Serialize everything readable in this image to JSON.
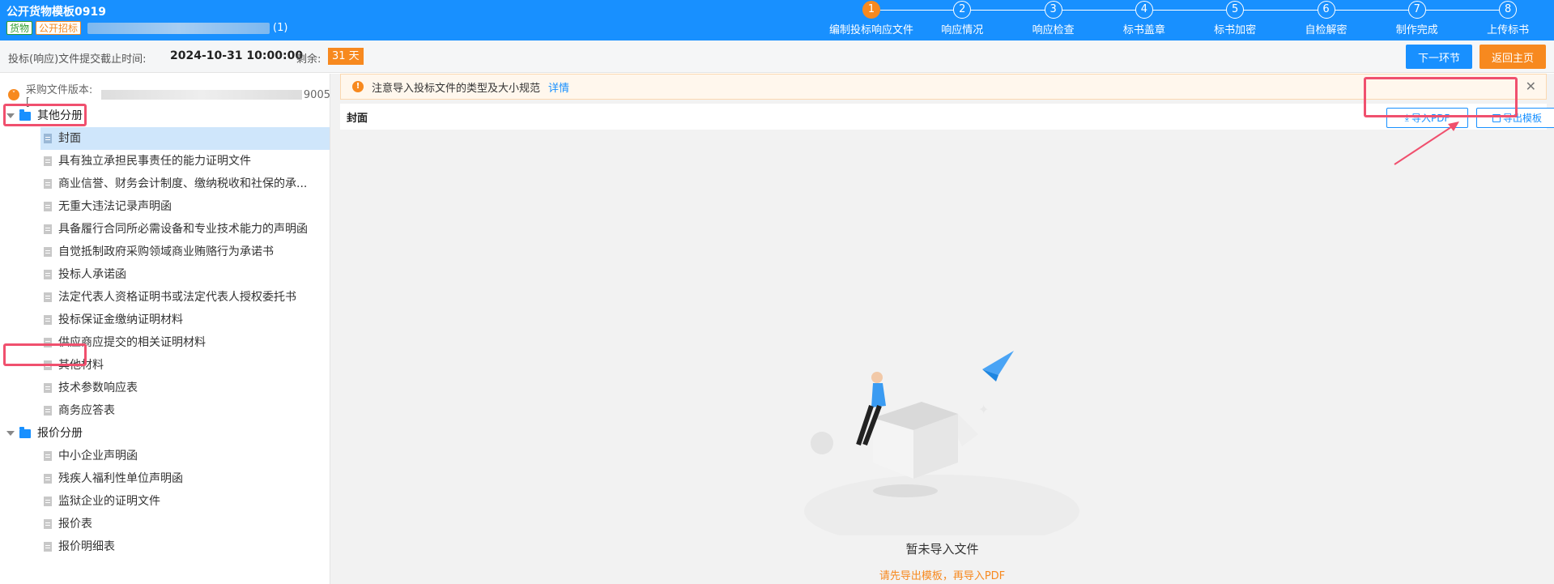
{
  "header": {
    "title": "公开货物模板0919",
    "tags": [
      "货物",
      "公开招标"
    ],
    "count_suffix": "(1)"
  },
  "steps": [
    {
      "num": "1",
      "label": "编制投标响应文件",
      "active": true
    },
    {
      "num": "2",
      "label": "响应情况",
      "active": false
    },
    {
      "num": "3",
      "label": "响应检查",
      "active": false
    },
    {
      "num": "4",
      "label": "标书盖章",
      "active": false
    },
    {
      "num": "5",
      "label": "标书加密",
      "active": false
    },
    {
      "num": "6",
      "label": "自检解密",
      "active": false
    },
    {
      "num": "7",
      "label": "制作完成",
      "active": false
    },
    {
      "num": "8",
      "label": "上传标书",
      "active": false
    }
  ],
  "subbar": {
    "deadline_label": "投标(响应)文件提交截止时间:",
    "deadline": "2024-10-31 10:00:00",
    "remain_label": "剩余:",
    "remain": "31 天",
    "next_button": "下一环节",
    "home_button": "返回主页"
  },
  "sidebar": {
    "version_prefix": "采购文件版本: [",
    "version_suffix": "9005",
    "groups": [
      {
        "name": "其他分册",
        "items": [
          "封面",
          "具有独立承担民事责任的能力证明文件",
          "商业信誉、财务会计制度、缴纳税收和社保的承...",
          "无重大违法记录声明函",
          "具备履行合同所必需设备和专业技术能力的声明函",
          "自觉抵制政府采购领域商业贿赂行为承诺书",
          "投标人承诺函",
          "法定代表人资格证明书或法定代表人授权委托书",
          "投标保证金缴纳证明材料",
          "供应商应提交的相关证明材料",
          "其他材料",
          "技术参数响应表",
          "商务应答表"
        ]
      },
      {
        "name": "报价分册",
        "items": [
          "中小企业声明函",
          "残疾人福利性单位声明函",
          "监狱企业的证明文件",
          "报价表",
          "报价明细表"
        ]
      }
    ],
    "selected": "封面"
  },
  "main": {
    "notice": "注意导入投标文件的类型及大小规范",
    "notice_link": "详情",
    "section_title": "封面",
    "import_button": "导入PDF",
    "export_button": "导出模板",
    "empty_title": "暂未导入文件",
    "empty_hint": "请先导出模板，再导入PDF"
  },
  "colors": {
    "primary": "#1890ff",
    "accent": "#f7891f",
    "highlight": "#f0506e"
  }
}
